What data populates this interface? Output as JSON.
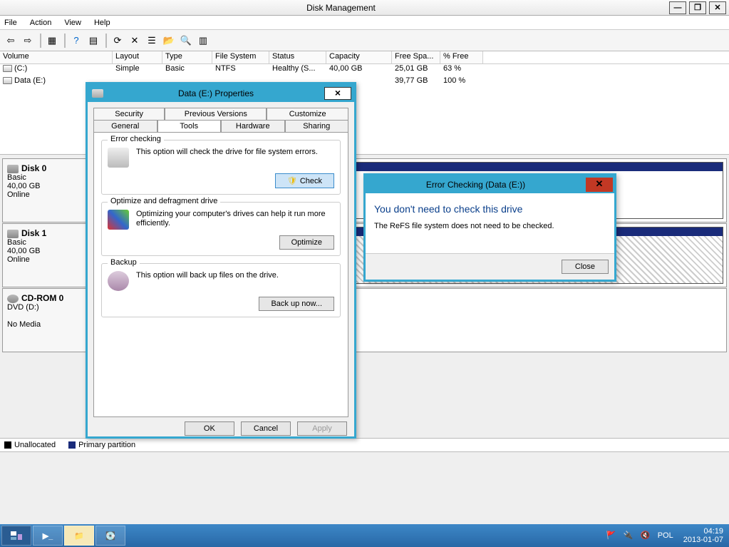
{
  "window": {
    "title": "Disk Management"
  },
  "menu": {
    "file": "File",
    "action": "Action",
    "view": "View",
    "help": "Help"
  },
  "columns": {
    "volume": "Volume",
    "layout": "Layout",
    "type": "Type",
    "fs": "File System",
    "status": "Status",
    "capacity": "Capacity",
    "free": "Free Spa...",
    "pct": "% Free"
  },
  "volumes": [
    {
      "name": "(C:)",
      "layout": "Simple",
      "type": "Basic",
      "fs": "NTFS",
      "status": "Healthy (S...",
      "capacity": "40,00 GB",
      "free": "25,01 GB",
      "pct": "63 %"
    },
    {
      "name": "Data (E:)",
      "layout": "",
      "type": "",
      "fs": "",
      "status": "",
      "capacity": "",
      "free": "39,77 GB",
      "pct": "100 %"
    }
  ],
  "disks": [
    {
      "name": "Disk 0",
      "type": "Basic",
      "size": "40,00 GB",
      "state": "Online"
    },
    {
      "name": "Disk 1",
      "type": "Basic",
      "size": "40,00 GB",
      "state": "Online"
    },
    {
      "name": "CD-ROM 0",
      "type": "DVD (D:)",
      "size": "",
      "state": "No Media"
    }
  ],
  "legend": {
    "unalloc": "Unallocated",
    "primary": "Primary partition"
  },
  "props": {
    "title": "Data (E:) Properties",
    "tabs_back": {
      "security": "Security",
      "prev": "Previous Versions",
      "custom": "Customize"
    },
    "tabs_front": {
      "general": "General",
      "tools": "Tools",
      "hw": "Hardware",
      "sharing": "Sharing"
    },
    "err": {
      "title": "Error checking",
      "text": "This option will check the drive for file system errors.",
      "btn": "Check"
    },
    "opt": {
      "title": "Optimize and defragment drive",
      "text": "Optimizing your computer's drives can help it run more efficiently.",
      "btn": "Optimize"
    },
    "bak": {
      "title": "Backup",
      "text": "This option will back up files on the drive.",
      "btn": "Back up now..."
    },
    "ok": "OK",
    "cancel": "Cancel",
    "apply": "Apply"
  },
  "msg": {
    "title": "Error Checking (Data (E:))",
    "head": "You don't need to check this drive",
    "text": "The ReFS file system does not need to be checked.",
    "close": "Close"
  },
  "tray": {
    "lang": "POL",
    "time": "04:19",
    "date": "2013-01-07"
  }
}
